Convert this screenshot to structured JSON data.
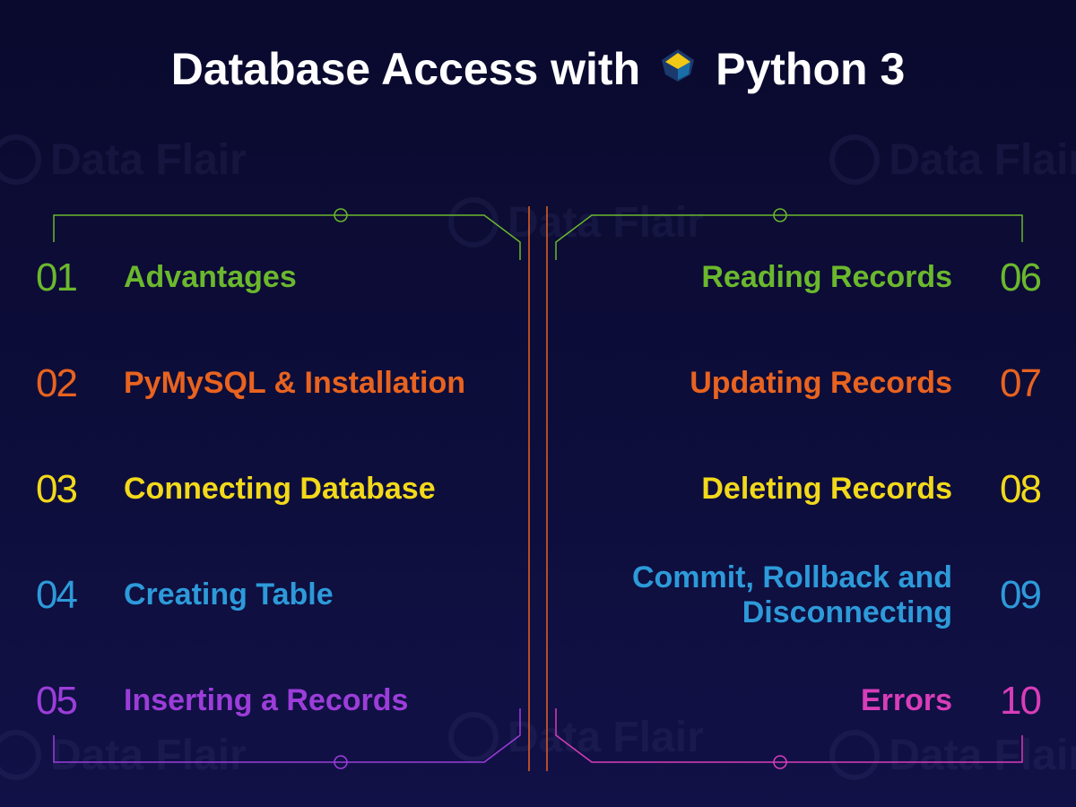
{
  "header": {
    "title_left": "Database Access with",
    "title_right": "Python 3",
    "logo_name": "python-logo-icon"
  },
  "watermark_text": "Data Flair",
  "items_left": [
    {
      "num": "01",
      "label": "Advantages",
      "color": "c1"
    },
    {
      "num": "02",
      "label": "PyMySQL & Installation",
      "color": "c2"
    },
    {
      "num": "03",
      "label": "Connecting Database",
      "color": "c3"
    },
    {
      "num": "04",
      "label": "Creating Table",
      "color": "c4"
    },
    {
      "num": "05",
      "label": "Inserting a Records",
      "color": "c5"
    }
  ],
  "items_right": [
    {
      "num": "06",
      "label": "Reading Records",
      "color": "c1"
    },
    {
      "num": "07",
      "label": "Updating Records",
      "color": "c2"
    },
    {
      "num": "08",
      "label": "Deleting Records",
      "color": "c3"
    },
    {
      "num": "09",
      "label": "Commit, Rollback and Disconnecting",
      "color": "c4"
    },
    {
      "num": "10",
      "label": "Errors",
      "color": "c10"
    }
  ],
  "connector_colors": {
    "green": "#6bb82d",
    "orange": "#e8631f",
    "yellow": "#f2d91a",
    "blue": "#2d9ad9",
    "purple": "#9c3dd9",
    "magenta": "#d93db8"
  }
}
